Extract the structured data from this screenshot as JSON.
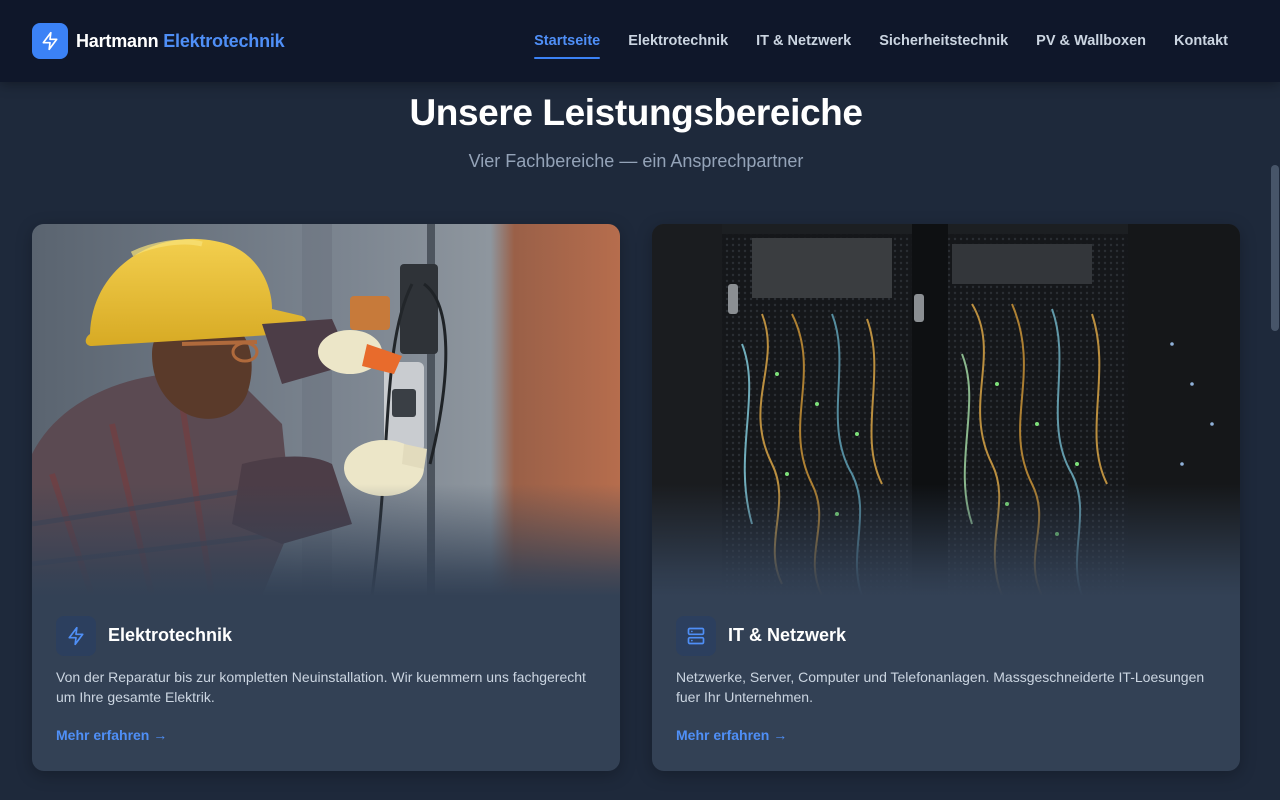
{
  "brand": {
    "name": "Hartmann",
    "accent": "Elektrotechnik",
    "icon": "lightning-bolt-icon",
    "accent_color": "#3b82f6"
  },
  "nav": {
    "items": [
      {
        "label": "Startseite",
        "active": true
      },
      {
        "label": "Elektrotechnik",
        "active": false
      },
      {
        "label": "IT & Netzwerk",
        "active": false
      },
      {
        "label": "Sicherheitstechnik",
        "active": false
      },
      {
        "label": "PV & Wallboxen",
        "active": false
      },
      {
        "label": "Kontakt",
        "active": false
      }
    ]
  },
  "section": {
    "title": "Unsere Leistungsbereiche",
    "subtitle": "Vier Fachbereiche — ein Ansprechpartner"
  },
  "cards": [
    {
      "icon": "lightning-bolt-icon",
      "title": "Elektrotechnik",
      "description": "Von der Reparatur bis zur kompletten Neuinstallation. Wir kuemmern uns fachgerecht um Ihre gesamte Elektrik.",
      "link": "Mehr erfahren →"
    },
    {
      "icon": "server-icon",
      "title": "IT & Netzwerk",
      "description": "Netzwerke, Server, Computer und Telefonanlagen. Massgeschneiderte IT-Loesungen fuer Ihr Unternehmen.",
      "link": "Mehr erfahren →"
    }
  ]
}
